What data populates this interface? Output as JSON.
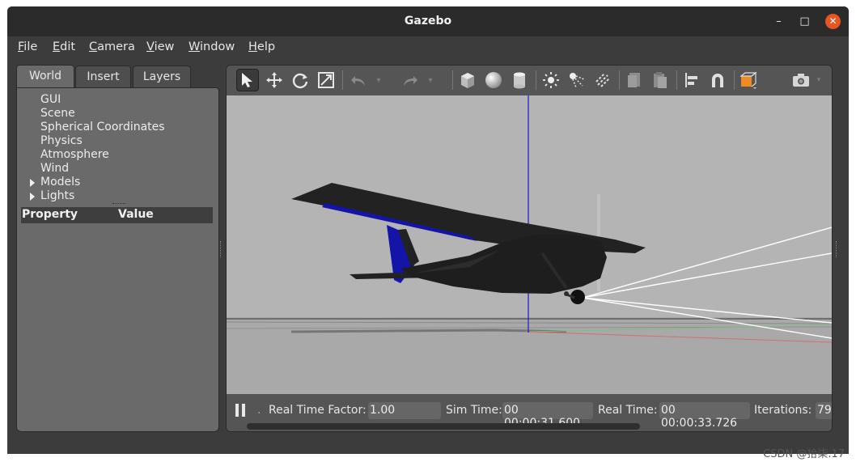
{
  "window": {
    "title": "Gazebo"
  },
  "menubar": {
    "items": [
      {
        "mnemonic": "F",
        "rest": "ile"
      },
      {
        "mnemonic": "E",
        "rest": "dit"
      },
      {
        "mnemonic": "C",
        "rest": "amera"
      },
      {
        "mnemonic": "V",
        "rest": "iew"
      },
      {
        "mnemonic": "W",
        "rest": "indow"
      },
      {
        "mnemonic": "H",
        "rest": "elp"
      }
    ]
  },
  "left_panel": {
    "tabs": [
      "World",
      "Insert",
      "Layers"
    ],
    "active_tab": "World",
    "tree": [
      "GUI",
      "Scene",
      "Spherical Coordinates",
      "Physics",
      "Atmosphere",
      "Wind",
      "Models",
      "Lights"
    ],
    "property_header": {
      "property": "Property",
      "value": "Value"
    }
  },
  "toolbar": {
    "tools": [
      "select-arrow-icon",
      "translate-icon",
      "rotate-icon",
      "scale-icon",
      "undo-icon",
      "redo-icon",
      "box-icon",
      "sphere-icon",
      "cylinder-icon",
      "point-light-icon",
      "spot-light-icon",
      "directional-light-icon",
      "copy-icon",
      "paste-icon",
      "align-icon",
      "snap-icon",
      "view-angle-icon",
      "screenshot-icon"
    ]
  },
  "status": {
    "real_time_factor_label": "Real Time Factor:",
    "real_time_factor": "1.00",
    "sim_time_label": "Sim Time:",
    "sim_time": "00 00:00:31.600",
    "real_time_label": "Real Time:",
    "real_time": "00 00:00:33.726",
    "iterations_label": "Iterations:",
    "iterations": "79"
  },
  "watermark": "CSDN @拾柒.17"
}
